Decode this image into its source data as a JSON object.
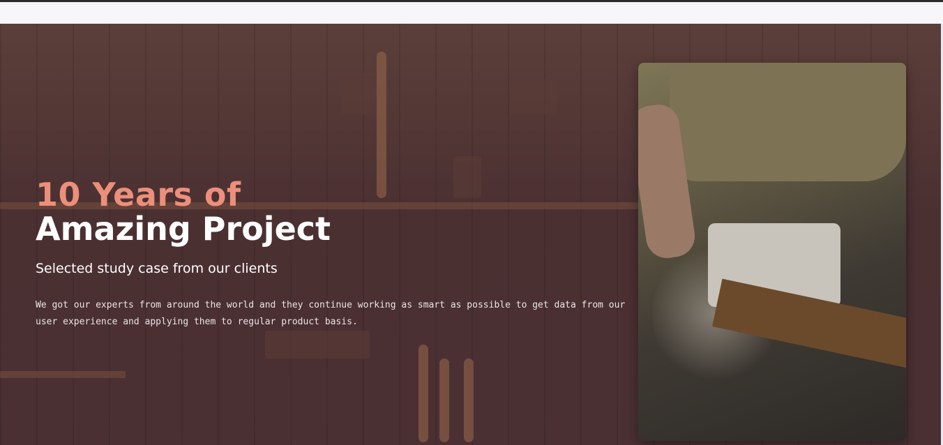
{
  "hero": {
    "heading_line1": "10 Years of",
    "heading_line2": "Amazing Project",
    "subtitle": "Selected study case from our clients",
    "description": "We got our experts from around the world and they continue working as smart as possible to get data from our user experience and applying them to regular product basis."
  },
  "colors": {
    "accent": "#ec8f7a",
    "overlay": "#4a3033",
    "text_light": "#ffffff"
  }
}
